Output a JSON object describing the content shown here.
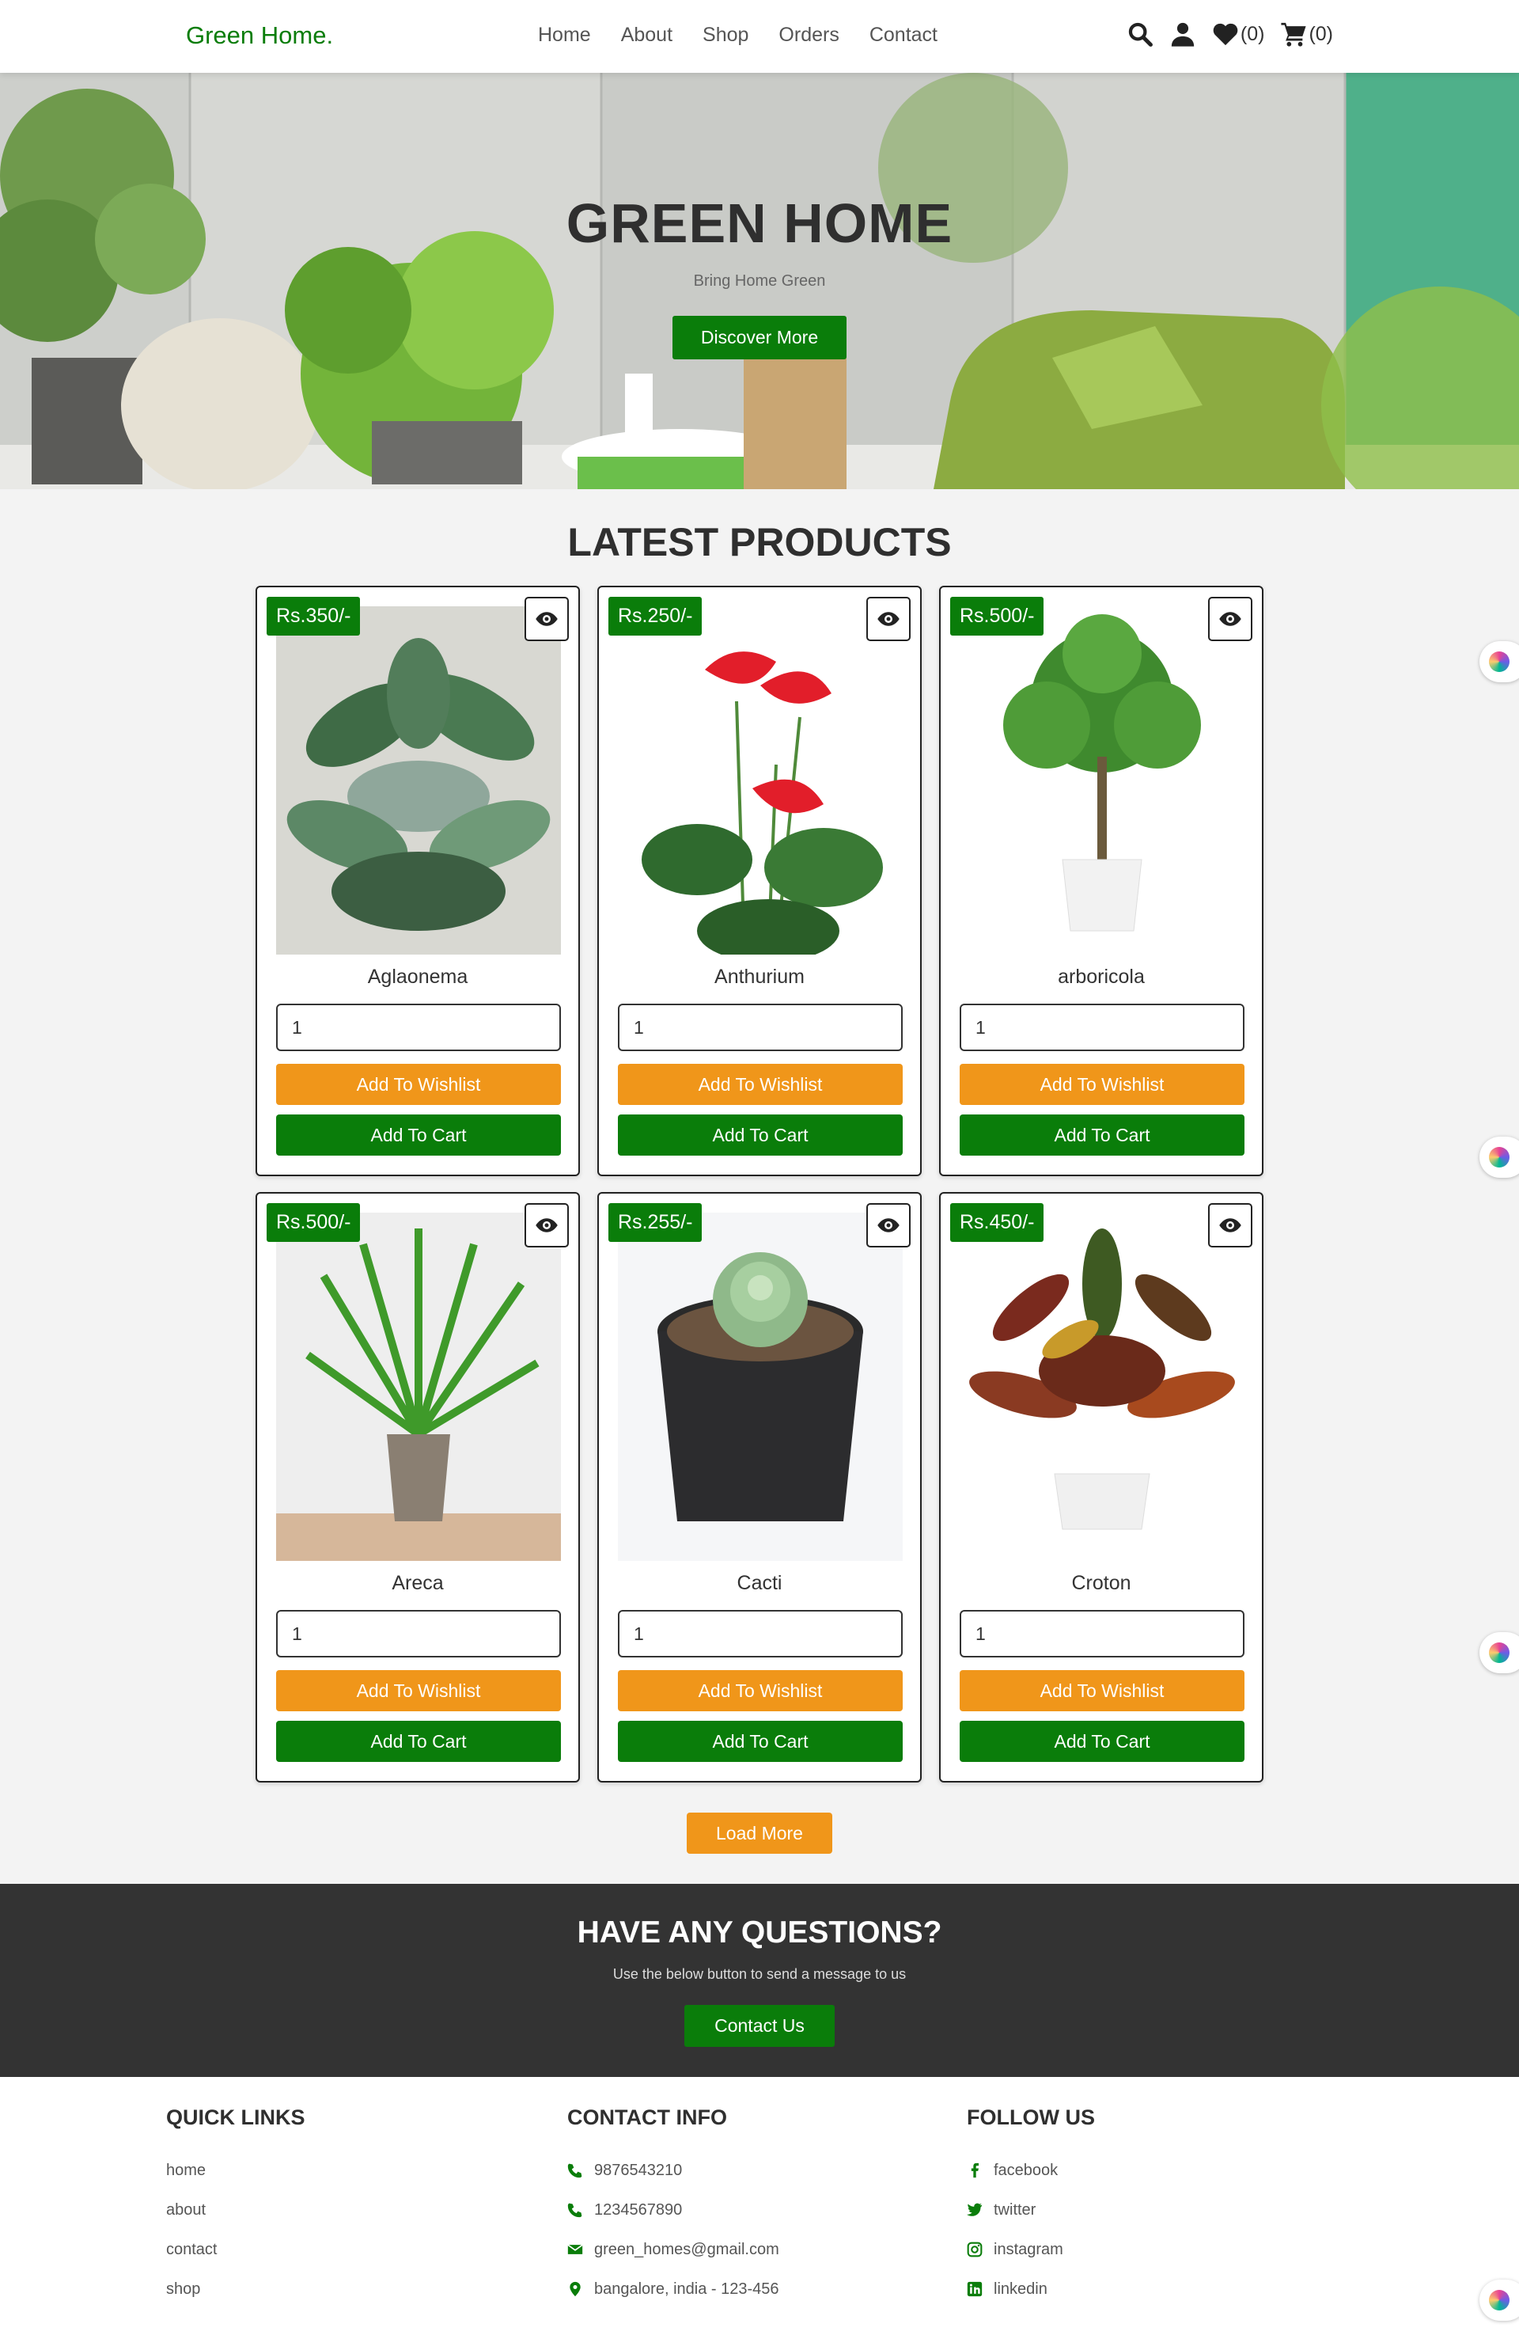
{
  "header": {
    "logo": "Green Home.",
    "nav": [
      "Home",
      "About",
      "Shop",
      "Orders",
      "Contact"
    ],
    "wishlist_count": "(0)",
    "cart_count": "(0)"
  },
  "hero": {
    "title": "GREEN HOME",
    "subtitle": "Bring Home Green",
    "button": "Discover More"
  },
  "products": {
    "title": "LATEST PRODUCTS",
    "items": [
      {
        "price": "Rs.350/-",
        "name": "Aglaonema",
        "qty": "1",
        "wishlist": "Add To Wishlist",
        "cart": "Add To Cart"
      },
      {
        "price": "Rs.250/-",
        "name": "Anthurium",
        "qty": "1",
        "wishlist": "Add To Wishlist",
        "cart": "Add To Cart"
      },
      {
        "price": "Rs.500/-",
        "name": "arboricola",
        "qty": "1",
        "wishlist": "Add To Wishlist",
        "cart": "Add To Cart"
      },
      {
        "price": "Rs.500/-",
        "name": "Areca",
        "qty": "1",
        "wishlist": "Add To Wishlist",
        "cart": "Add To Cart"
      },
      {
        "price": "Rs.255/-",
        "name": "Cacti",
        "qty": "1",
        "wishlist": "Add To Wishlist",
        "cart": "Add To Cart"
      },
      {
        "price": "Rs.450/-",
        "name": "Croton",
        "qty": "1",
        "wishlist": "Add To Wishlist",
        "cart": "Add To Cart"
      }
    ],
    "load_more": "Load More"
  },
  "questions": {
    "title": "HAVE ANY QUESTIONS?",
    "subtitle": "Use the below button to send a message to us",
    "button": "Contact Us"
  },
  "footer": {
    "quick_links": {
      "title": "QUICK LINKS",
      "items": [
        "home",
        "about",
        "contact",
        "shop"
      ]
    },
    "contact_info": {
      "title": "CONTACT INFO",
      "items": [
        "9876543210",
        "1234567890",
        "green_homes@gmail.com",
        "bangalore, india - 123-456"
      ]
    },
    "follow_us": {
      "title": "FOLLOW US",
      "items": [
        "facebook",
        "twitter",
        "instagram",
        "linkedin"
      ]
    }
  },
  "colors": {
    "brand_green": "#0a7d0a",
    "accent_orange": "#f0961a",
    "dark_band": "#333333"
  }
}
